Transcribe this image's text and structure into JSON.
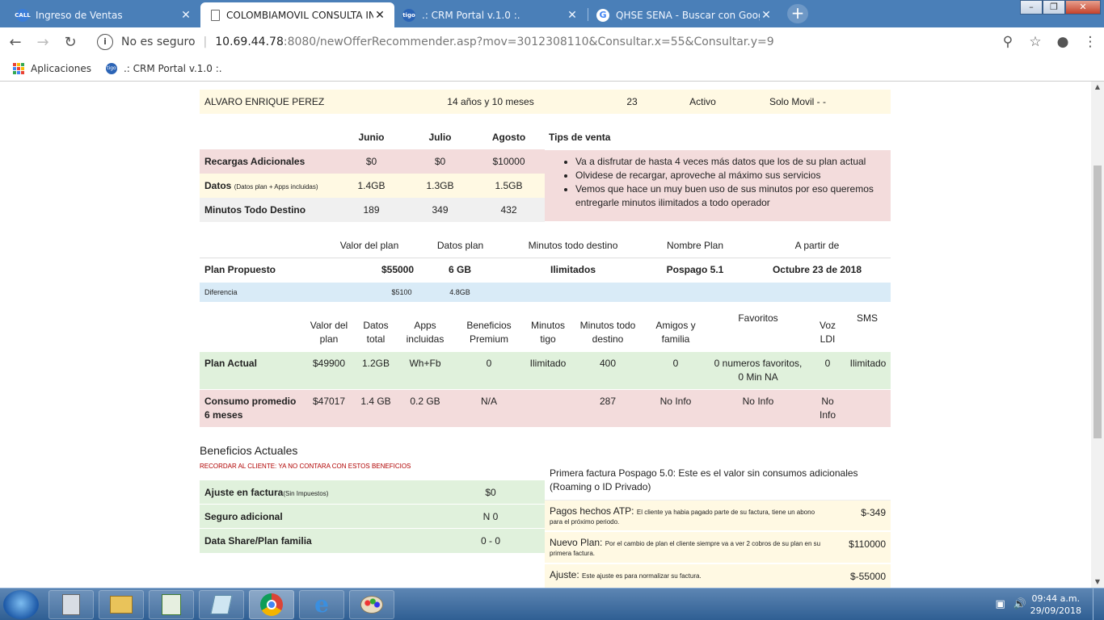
{
  "browser": {
    "tabs": [
      {
        "title": "Ingreso de Ventas",
        "icon": "call-icon"
      },
      {
        "title": "COLOMBIAMOVIL CONSULTA IN",
        "icon": "page-icon"
      },
      {
        "title": ".: CRM Portal v.1.0 :.",
        "icon": "crm-icon"
      },
      {
        "title": "QHSE SENA - Buscar con Google",
        "icon": "google-icon"
      }
    ],
    "security_label": "No es seguro",
    "url_host": "10.69.44.78",
    "url_path": ":8080/newOfferRecommender.asp?mov=3012308110&Consultar.x=55&Consultar.y=9",
    "bookmarks": {
      "apps": "Aplicaciones",
      "crm": ".: CRM Portal v.1.0 :."
    }
  },
  "customer": {
    "name": "ALVARO ENRIQUE PEREZ",
    "tenure": "14 años y 10 meses",
    "number": "23",
    "status": "Activo",
    "type": "Solo Movil - -"
  },
  "usage": {
    "months": [
      "Junio",
      "Julio",
      "Agosto"
    ],
    "tips_title": "Tips de venta",
    "rows": [
      {
        "label": "Recargas Adicionales",
        "note": "",
        "values": [
          "$0",
          "$0",
          "$10000"
        ]
      },
      {
        "label": "Datos",
        "note": "(Datos plan + Apps incluidas)",
        "values": [
          "1.4GB",
          "1.3GB",
          "1.5GB"
        ]
      },
      {
        "label": "Minutos Todo Destino",
        "note": "",
        "values": [
          "189",
          "349",
          "432"
        ]
      }
    ],
    "tips": [
      "Va a disfrutar de hasta 4 veces más datos que los de su plan actual",
      "Olvidese de recargar, aproveche al máximo sus servicios",
      "Vemos que hace un muy buen uso de sus minutos por eso queremos entregarle minutos ilimitados a todo operador"
    ]
  },
  "proposed": {
    "headers": [
      "Valor del plan",
      "Datos plan",
      "Minutos todo destino",
      "Nombre Plan",
      "A partir de"
    ],
    "label": "Plan Propuesto",
    "values": [
      "$55000",
      "6 GB",
      "Ilimitados",
      "Pospago 5.1",
      "Octubre 23 de 2018"
    ],
    "diff_label": "Diferencia",
    "diff_values": [
      "$5100",
      "4.8GB"
    ]
  },
  "current": {
    "headers": [
      "Valor del plan",
      "Datos total",
      "Apps incluidas",
      "Beneficios Premium",
      "Minutos tigo",
      "Minutos todo destino",
      "Amigos y familia",
      "Favoritos",
      "Voz LDI",
      "SMS"
    ],
    "plan_label": "Plan Actual",
    "plan_values": [
      "$49900",
      "1.2GB",
      "Wh+Fb",
      "0",
      "Ilimitado",
      "400",
      "0",
      "0 numeros favoritos, 0 Min NA",
      "0",
      "Ilimitado"
    ],
    "consumo_label": "Consumo promedio 6 meses",
    "consumo_values": [
      "$47017",
      "1.4 GB",
      "0.2 GB",
      "N/A",
      "",
      "287",
      "No Info",
      "No Info",
      "No Info",
      ""
    ]
  },
  "benefits": {
    "title": "Beneficios Actuales",
    "warning": "RECORDAR AL CLIENTE: YA NO CONTARA CON ESTOS BENEFICIOS",
    "rows": [
      {
        "label": "Ajuste en factura",
        "note": "(Sin Impuestos)",
        "value": "$0"
      },
      {
        "label": "Seguro adicional",
        "note": "",
        "value": "N 0"
      },
      {
        "label": "Data Share/Plan familia",
        "note": "",
        "value": "0 - 0"
      }
    ]
  },
  "invoice": {
    "title": "Primera factura Pospago 5.0: Este es el valor sin consumos adicionales (Roaming o ID Privado)",
    "rows": [
      {
        "label": "Pagos hechos ATP:",
        "note": "El cliente ya habia pagado parte de su factura, tiene un abono para el próximo periodo.",
        "value": "$-349"
      },
      {
        "label": "Nuevo Plan:",
        "note": "Por el cambio de plan el cliente siempre va a ver 2 cobros de su plan en su primera factura.",
        "value": "$110000"
      },
      {
        "label": "Ajuste:",
        "note": "Este ajuste es para normalizar su factura.",
        "value": "$-55000"
      }
    ]
  },
  "taskbar": {
    "time": "09:44 a.m.",
    "date": "29/09/2018"
  }
}
